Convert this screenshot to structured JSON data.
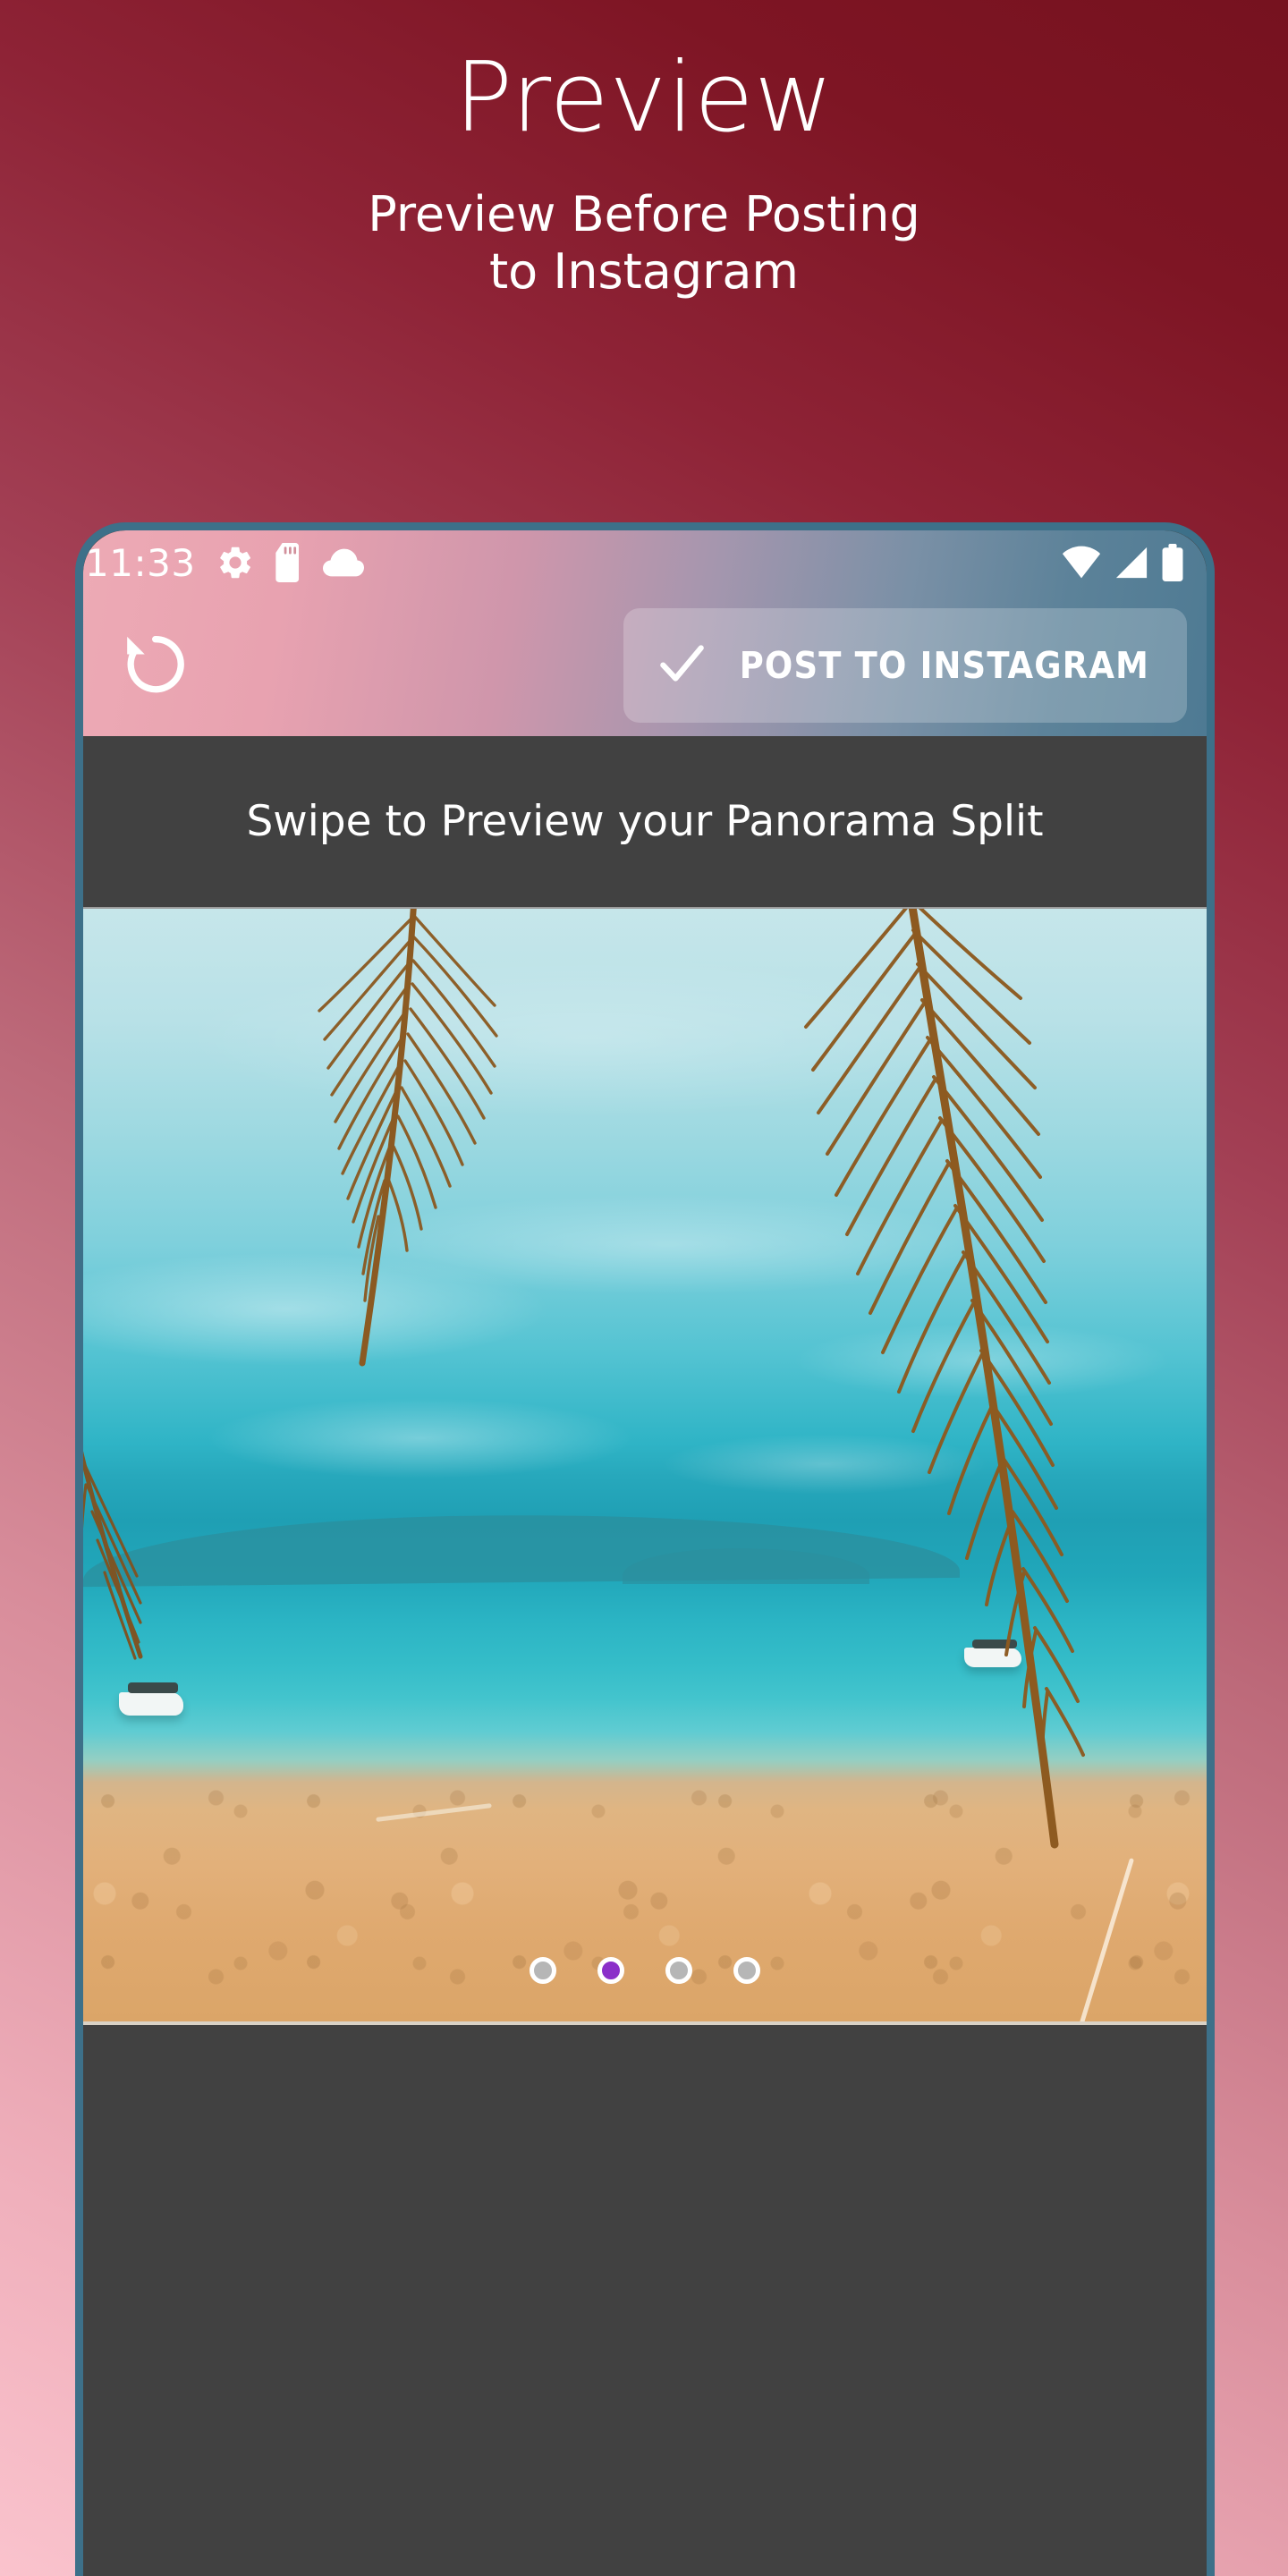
{
  "promo": {
    "title": "Preview",
    "subtitle_line1": "Preview Before Posting",
    "subtitle_line2": "to Instagram",
    "background_start": "#fac3cd",
    "background_end": "#76121f"
  },
  "phone": {
    "frame_color": "#3d7089",
    "status_bar": {
      "time": "11:33",
      "left_icons": [
        "gear-icon",
        "sd-card-icon",
        "cloud-icon"
      ],
      "right_icons": [
        "wifi-icon",
        "cell-signal-icon",
        "battery-icon"
      ]
    },
    "app_bar": {
      "undo_icon": "rotate-left-icon",
      "post_button": {
        "icon": "check-icon",
        "label": "POST TO INSTAGRAM"
      }
    },
    "hint_banner": {
      "text": "Swipe to Preview your Panorama Split",
      "background": "#414141"
    },
    "preview": {
      "image_description": "Tropical beach with palm fronds, turquoise sea, moored boats and golden sand",
      "pagination": {
        "total": 4,
        "active_index": 1,
        "active_color": "#8b2fc9",
        "inactive_color": "#b6b6b6",
        "ring_color": "#ffffff"
      }
    },
    "lower_panel": {
      "background": "#414141"
    }
  }
}
